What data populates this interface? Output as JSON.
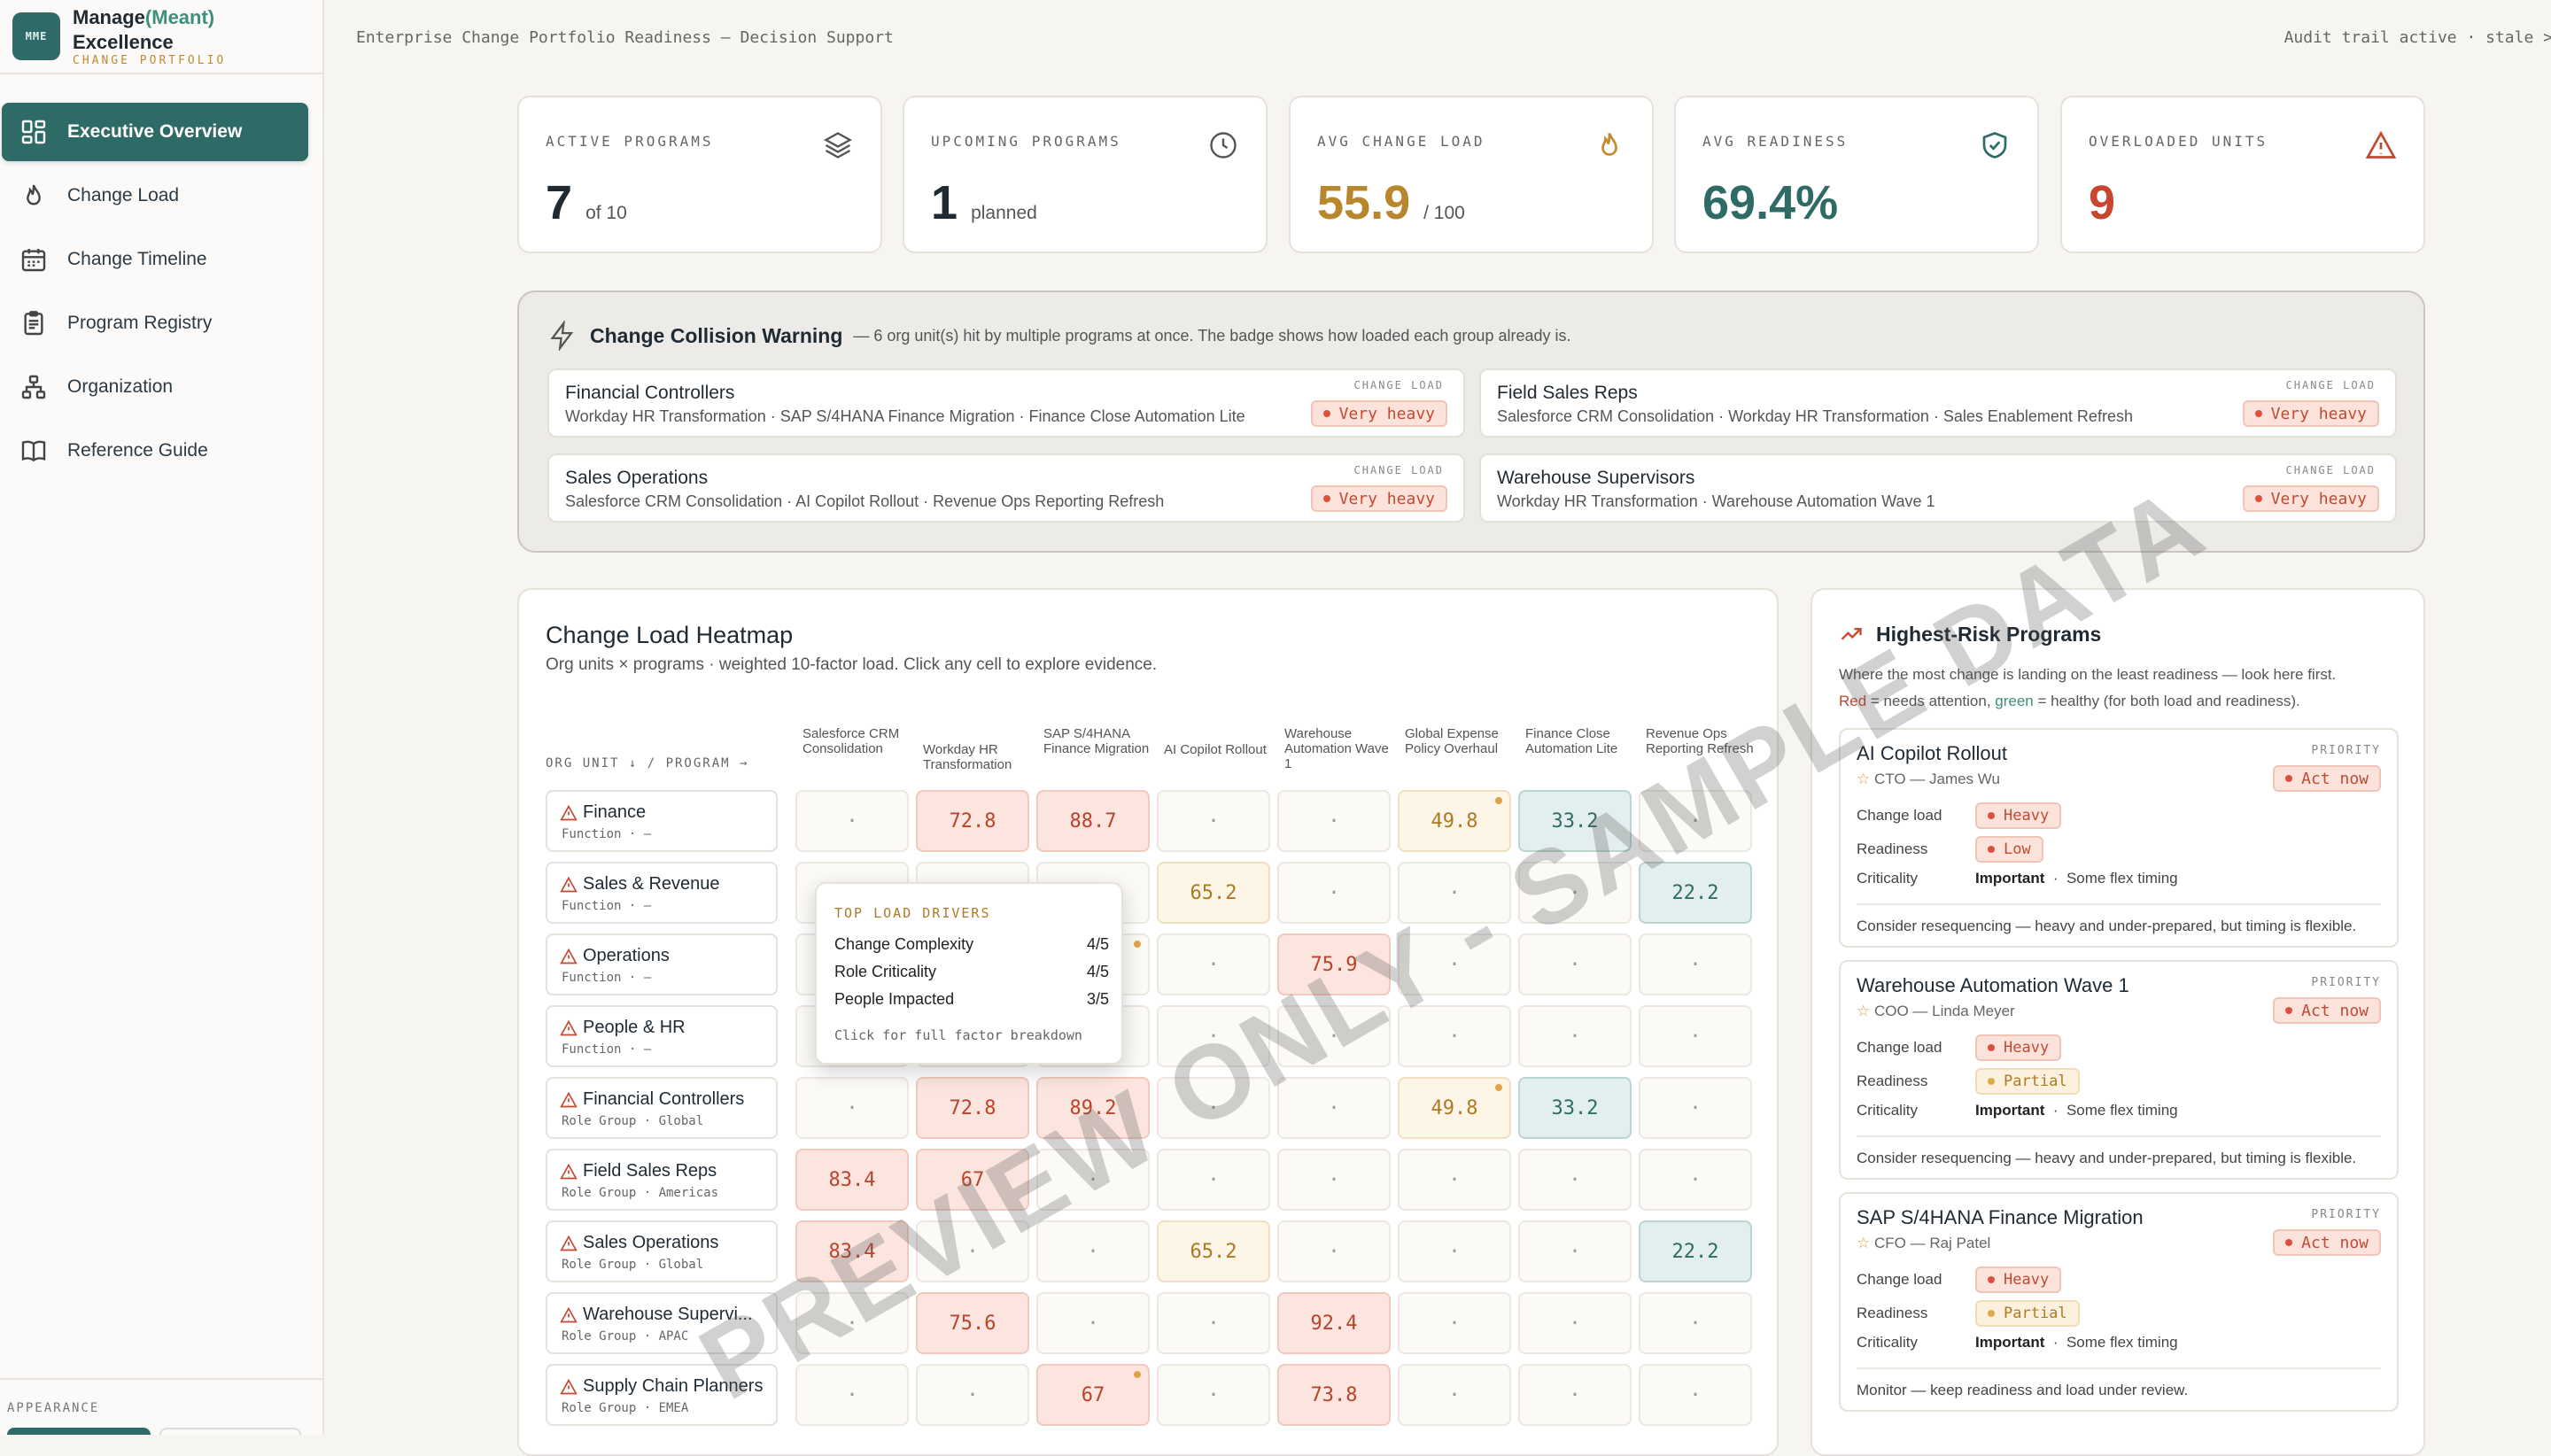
{
  "brand": {
    "logo": "MME",
    "name_a": "Manage",
    "name_b": "(Meant)",
    "name_c": "Excellence",
    "sub": "CHANGE PORTFOLIO"
  },
  "nav": [
    {
      "label": "Executive Overview",
      "icon": "dashboard-icon"
    },
    {
      "label": "Change Load",
      "icon": "flame-icon"
    },
    {
      "label": "Change Timeline",
      "icon": "calendar-icon"
    },
    {
      "label": "Program Registry",
      "icon": "clipboard-icon"
    },
    {
      "label": "Organization",
      "icon": "org-chart-icon"
    },
    {
      "label": "Reference Guide",
      "icon": "book-icon"
    }
  ],
  "appearance": "APPEARANCE",
  "topbar": {
    "title": "Enterprise Change Portfolio Readiness — Decision Support",
    "status": "Audit trail active · stale >"
  },
  "kpis": [
    {
      "label": "ACTIVE PROGRAMS",
      "value": "7",
      "suffix": "of 10",
      "icon": "layers-icon",
      "color": "#1f2a33"
    },
    {
      "label": "UPCOMING PROGRAMS",
      "value": "1",
      "suffix": "planned",
      "icon": "clock-icon",
      "color": "#1f2a33"
    },
    {
      "label": "AVG CHANGE LOAD",
      "value": "55.9",
      "suffix": "/ 100",
      "icon": "flame-icon",
      "color": "#b8862c"
    },
    {
      "label": "AVG READINESS",
      "value": "69.4%",
      "suffix": "",
      "icon": "shield-check-icon",
      "color": "#2f6b66"
    },
    {
      "label": "OVERLOADED UNITS",
      "value": "9",
      "suffix": "",
      "icon": "warning-icon",
      "color": "#c8452e"
    }
  ],
  "collision": {
    "title": "Change Collision Warning",
    "desc": "— 6 org unit(s) hit by multiple programs at once. The badge shows how loaded each group already is.",
    "load_label": "CHANGE LOAD",
    "cards": [
      {
        "name": "Financial Controllers",
        "programs": "Workday HR Transformation · SAP S/4HANA Finance Migration · Finance Close Automation Lite",
        "badge": "Very heavy"
      },
      {
        "name": "Field Sales Reps",
        "programs": "Salesforce CRM Consolidation · Workday HR Transformation · Sales Enablement Refresh",
        "badge": "Very heavy"
      },
      {
        "name": "Sales Operations",
        "programs": "Salesforce CRM Consolidation · AI Copilot Rollout · Revenue Ops Reporting Refresh",
        "badge": "Very heavy"
      },
      {
        "name": "Warehouse Supervisors",
        "programs": "Workday HR Transformation · Warehouse Automation Wave 1",
        "badge": "Very heavy"
      }
    ]
  },
  "heatmap": {
    "title": "Change Load Heatmap",
    "subtitle": "Org units × programs · weighted 10-factor load. Click any cell to explore evidence.",
    "corner": "ORG UNIT ↓ / PROGRAM →",
    "columns": [
      "Salesforce CRM Consolidation",
      "Workday HR Transformation",
      "SAP S/4HANA Finance Migration",
      "AI Copilot Rollout",
      "Warehouse Automation Wave 1",
      "Global Expense Policy Overhaul",
      "Finance Close Automation Lite",
      "Revenue Ops Reporting Refresh"
    ],
    "rows": [
      {
        "name": "Finance",
        "sub": "Function · —",
        "cells": [
          "·",
          "72.8",
          "88.7",
          "·",
          "·",
          "49.8",
          "33.2",
          "·"
        ]
      },
      {
        "name": "Sales & Revenue",
        "sub": "Function · —",
        "cells": [
          "",
          "",
          "",
          "65.2",
          "·",
          "·",
          "·",
          "22.2"
        ]
      },
      {
        "name": "Operations",
        "sub": "Function · —",
        "cells": [
          "",
          "",
          "",
          "·",
          "75.9",
          "·",
          "·",
          "·"
        ]
      },
      {
        "name": "People & HR",
        "sub": "Function · —",
        "cells": [
          "",
          "",
          "",
          "·",
          "·",
          "·",
          "·",
          "·"
        ]
      },
      {
        "name": "Financial Controllers",
        "sub": "Role Group · Global",
        "cells": [
          "·",
          "72.8",
          "89.2",
          "·",
          "·",
          "49.8",
          "33.2",
          "·"
        ]
      },
      {
        "name": "Field Sales Reps",
        "sub": "Role Group · Americas",
        "cells": [
          "83.4",
          "67",
          "·",
          "·",
          "·",
          "·",
          "·",
          "·"
        ]
      },
      {
        "name": "Sales Operations",
        "sub": "Role Group · Global",
        "cells": [
          "83.4",
          "·",
          "·",
          "65.2",
          "·",
          "·",
          "·",
          "22.2"
        ]
      },
      {
        "name": "Warehouse Supervi...",
        "sub": "Role Group · APAC",
        "cells": [
          "·",
          "75.6",
          "·",
          "·",
          "92.4",
          "·",
          "·",
          "·"
        ]
      },
      {
        "name": "Supply Chain Planners",
        "sub": "Role Group · EMEA",
        "cells": [
          "·",
          "·",
          "67",
          "·",
          "73.8",
          "·",
          "·",
          "·"
        ]
      }
    ],
    "tooltip": {
      "title": "TOP LOAD DRIVERS",
      "rows": [
        {
          "label": "Change Complexity",
          "value": "4/5"
        },
        {
          "label": "Role Criticality",
          "value": "4/5"
        },
        {
          "label": "People Impacted",
          "value": "3/5"
        }
      ],
      "footer": "Click for full factor breakdown"
    }
  },
  "risk": {
    "title": "Highest-Risk Programs",
    "desc1": "Where the most change is landing on the least readiness — look here first.",
    "desc2_red": "Red",
    "desc2_mid": " = needs attention, ",
    "desc2_green": "green",
    "desc2_end": " = healthy (for both load and readiness).",
    "priority_label": "PRIORITY",
    "labels": {
      "load": "Change load",
      "readiness": "Readiness",
      "criticality": "Criticality"
    },
    "cards": [
      {
        "name": "AI Copilot Rollout",
        "owner": "CTO — James Wu",
        "priority": "Act now",
        "load": "Heavy",
        "readiness": "Low",
        "criticality": "Important",
        "timing": "Some flex timing",
        "note": "Consider resequencing — heavy and under-prepared, but timing is flexible."
      },
      {
        "name": "Warehouse Automation Wave 1",
        "owner": "COO — Linda Meyer",
        "priority": "Act now",
        "load": "Heavy",
        "readiness": "Partial",
        "criticality": "Important",
        "timing": "Some flex timing",
        "note": "Consider resequencing — heavy and under-prepared, but timing is flexible."
      },
      {
        "name": "SAP S/4HANA Finance Migration",
        "owner": "CFO — Raj Patel",
        "priority": "Act now",
        "load": "Heavy",
        "readiness": "Partial",
        "criticality": "Important",
        "timing": "Some flex timing",
        "note": "Monitor — keep readiness and load under review."
      }
    ]
  },
  "watermark": "PREVIEW ONLY - SAMPLE DATA"
}
